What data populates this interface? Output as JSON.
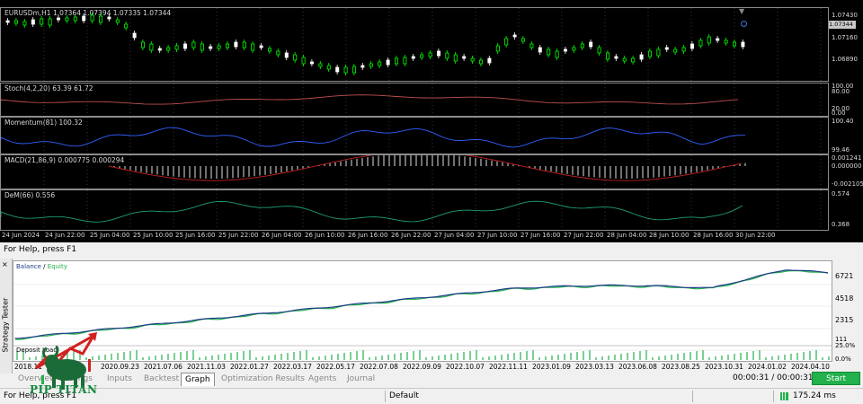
{
  "chart": {
    "main_label": "EURUSDm,H1  1.07364 1.07394 1.07335 1.07344",
    "price_axis": [
      "1.07430",
      "1.07160",
      "1.06890"
    ],
    "current_price": "1.07344",
    "stoch_label": "Stoch(4,2,20) 63.39 61.72",
    "stoch_axis": [
      "100.00",
      "80.00",
      "20.00",
      "0.00"
    ],
    "momentum_label": "Momentum(81) 100.32",
    "momentum_axis": [
      "100.40",
      "99.46"
    ],
    "macd_label": "MACD(21,86,9) 0.000775 0.000294",
    "macd_axis": [
      "0.001241",
      "0.000000",
      "-0.002105"
    ],
    "dem_label": "DeM(66) 0.556",
    "dem_axis": [
      "0.574",
      "0.368"
    ],
    "time_labels": [
      "24 Jun 2024",
      "24 Jun 22:00",
      "25 Jun 04:00",
      "25 Jun 10:00",
      "25 Jun 16:00",
      "25 Jun 22:00",
      "26 Jun 04:00",
      "26 Jun 10:00",
      "26 Jun 16:00",
      "26 Jun 22:00",
      "27 Jun 04:00",
      "27 Jun 10:00",
      "27 Jun 16:00",
      "27 Jun 22:00",
      "28 Jun 04:00",
      "28 Jun 10:00",
      "28 Jun 16:00",
      "30 Jun 22:00"
    ]
  },
  "help_bar": {
    "text": "For Help, press F1"
  },
  "tester": {
    "side_title": "Strategy Tester",
    "close_glyph": "×",
    "balance_label": "Balance",
    "legend_sep": " / ",
    "equity_label": "Equity",
    "balance_axis": [
      "6721",
      "4518",
      "2315",
      "111"
    ],
    "deposit_label": "Deposit Load",
    "load_axis": [
      "25.0%",
      "0.0%"
    ],
    "dates": [
      "2018.11",
      "2020.09.23",
      "2021.07.06",
      "2021.11.03",
      "2022.01.27",
      "2022.03.17",
      "2022.05.17",
      "2022.07.08",
      "2022.09.09",
      "2022.10.07",
      "2022.11.11",
      "2023.01.09",
      "2023.03.13",
      "2023.06.08",
      "2023.08.25",
      "2023.10.31",
      "2024.01.02",
      "2024.04.10"
    ],
    "tabs": [
      "Overview",
      "Settings",
      "Inputs",
      "Backtest",
      "Graph",
      "Optimization Results",
      "Agents",
      "Journal"
    ],
    "active_tab": "Graph",
    "timer": "00:00:31 / 00:00:31",
    "start_label": "Start"
  },
  "status_bar": {
    "help": "For Help, press F1",
    "profile": "Default",
    "ping": "175.24 ms"
  },
  "logo": {
    "text": "PIP TITAN"
  },
  "colors": {
    "up_candle": "#00ff00",
    "down_candle": "#ffffff",
    "stoch": "#c05050",
    "momentum": "#3060ff",
    "macd_hist": "#e0e0e0",
    "macd_signal": "#c02020",
    "dem": "#20a070",
    "balance": "#1f3c88",
    "equity": "#22b14c",
    "start": "#22b14c"
  }
}
